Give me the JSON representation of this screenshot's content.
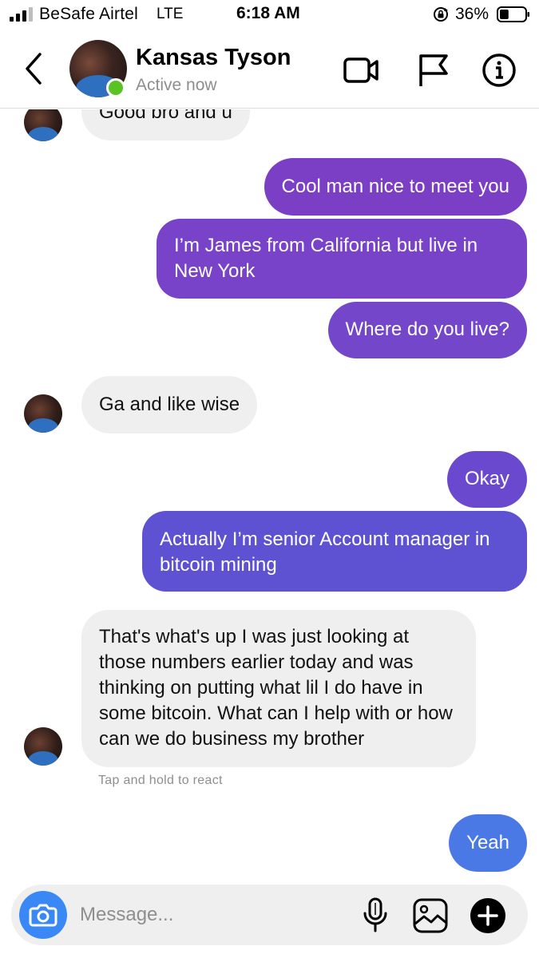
{
  "status_bar": {
    "carrier": "BeSafe Airtel",
    "network": "LTE",
    "time": "6:18 AM",
    "battery_percent": "36%",
    "signal_bars_filled": 3,
    "battery_level": 0.36,
    "icons": [
      "signal-icon",
      "rotation-lock-icon",
      "battery-icon"
    ]
  },
  "header": {
    "contact_name": "Kansas Tyson",
    "contact_status": "Active now",
    "icons": [
      "back-icon",
      "video-call-icon",
      "flag-icon",
      "info-icon"
    ]
  },
  "messages": [
    {
      "direction": "incoming",
      "text": "Good bro and u"
    },
    {
      "direction": "outgoing",
      "text": "Cool man nice to meet you"
    },
    {
      "direction": "outgoing",
      "text": "I’m James from California but live in New York"
    },
    {
      "direction": "outgoing",
      "text": "Where do you live?"
    },
    {
      "direction": "incoming",
      "text": "Ga and like wise"
    },
    {
      "direction": "outgoing",
      "text": "Okay"
    },
    {
      "direction": "outgoing",
      "text": "Actually I’m  senior Account manager in bitcoin mining"
    },
    {
      "direction": "incoming",
      "text": "That's what's up I was just looking at those numbers earlier today and was thinking on putting what lil I do have in some bitcoin. What can I help with or how can we do business my brother"
    },
    {
      "direction": "outgoing",
      "text": "Yeah"
    }
  ],
  "react_hint": "Tap and hold to react",
  "composer": {
    "placeholder": "Message...",
    "icons": [
      "camera-icon",
      "microphone-icon",
      "gallery-icon",
      "plus-icon"
    ]
  },
  "colors": {
    "incoming_bubble": "#efefef",
    "outgoing_purple": "#7b3fc6",
    "outgoing_violet": "#6a49cf",
    "outgoing_blue": "#4a79e6",
    "active_dot": "#58c322",
    "camera_button": "#3a87f6",
    "secondary_text": "#8e8e8e"
  }
}
